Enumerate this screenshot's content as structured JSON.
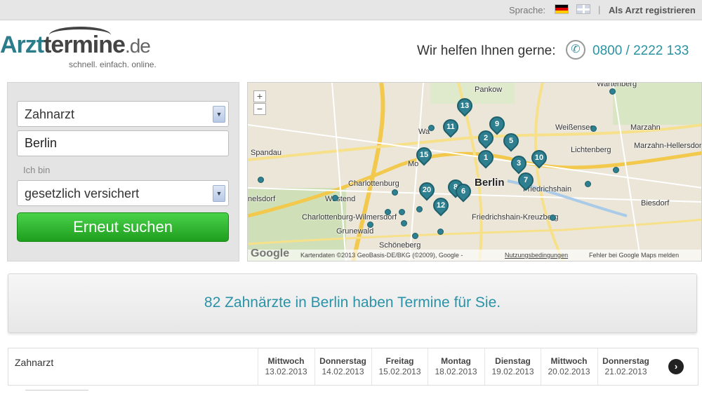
{
  "topbar": {
    "language_label": "Sprache:",
    "separator": "|",
    "register_label": "Als Arzt registrieren"
  },
  "header": {
    "logo_part1": "Arzt",
    "logo_part2": "termine",
    "logo_tld": ".de",
    "tagline": "schnell. einfach. online.",
    "help_text": "Wir helfen Ihnen gerne:",
    "phone": "0800 / 2222 133"
  },
  "search": {
    "specialty_value": "Zahnarzt",
    "city_value": "Berlin",
    "insurance_label": "Ich bin",
    "insurance_value": "gesetzlich versichert",
    "submit_label": "Erneut suchen"
  },
  "map": {
    "zoom_in": "+",
    "zoom_out": "−",
    "places": [
      {
        "name": "Pankow"
      },
      {
        "name": "Weißensee"
      },
      {
        "name": "Marzahn"
      },
      {
        "name": "Marzahn-Hellersdorf"
      },
      {
        "name": "Lichtenberg"
      },
      {
        "name": "Spandau"
      },
      {
        "name": "Charlottenburg"
      },
      {
        "name": "Berlin"
      },
      {
        "name": "Friedrichshain"
      },
      {
        "name": "Westend"
      },
      {
        "name": "Charlottenburg-Wilmersdorf"
      },
      {
        "name": "Grunewald"
      },
      {
        "name": "Friedrichshain-Kreuzberg"
      },
      {
        "name": "Biesdorf"
      },
      {
        "name": "Schöneberg"
      },
      {
        "name": "Mo"
      },
      {
        "name": "Wa"
      },
      {
        "name": "nelsdorf"
      },
      {
        "name": "Wartenberg"
      }
    ],
    "pins": [
      "13",
      "11",
      "9",
      "2",
      "5",
      "1",
      "10",
      "15",
      "3",
      "7",
      "20",
      "8",
      "6",
      "12"
    ],
    "google_logo": "Google",
    "attribution": "Kartendaten ©2013 GeoBasis-DE/BKG (©2009), Google -",
    "terms_label": "Nutzungsbedingungen",
    "report_label": "Fehler bei Google Maps melden"
  },
  "results": {
    "summary": "82 Zahnärzte in Berlin haben Termine für Sie."
  },
  "schedule": {
    "row_label": "Zahnarzt",
    "days": [
      {
        "name": "Mittwoch",
        "date": "13.02.2013"
      },
      {
        "name": "Donnerstag",
        "date": "14.02.2013"
      },
      {
        "name": "Freitag",
        "date": "15.02.2013"
      },
      {
        "name": "Montag",
        "date": "18.02.2013"
      },
      {
        "name": "Dienstag",
        "date": "19.02.2013"
      },
      {
        "name": "Mittwoch",
        "date": "20.02.2013"
      },
      {
        "name": "Donnerstag",
        "date": "21.02.2013"
      }
    ],
    "next_icon": "arrow-right-icon"
  }
}
